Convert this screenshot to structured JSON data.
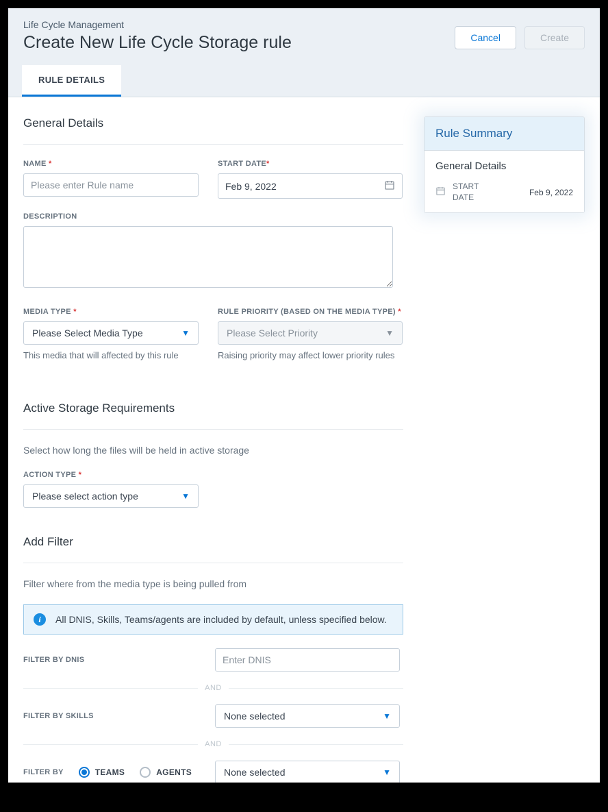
{
  "breadcrumb": "Life Cycle Management",
  "pageTitle": "Create New Life Cycle Storage rule",
  "buttons": {
    "cancel": "Cancel",
    "create": "Create"
  },
  "tab": "RULE DETAILS",
  "sections": {
    "general": {
      "title": "General Details",
      "nameLabel": "NAME",
      "namePlaceholder": "Please enter Rule name",
      "startDateLabel": "START DATE",
      "startDateValue": "Feb 9, 2022",
      "descriptionLabel": "DESCRIPTION",
      "mediaTypeLabel": "MEDIA TYPE",
      "mediaTypePlaceholder": "Please Select Media Type",
      "mediaTypeHelper": "This media that will affected by this rule",
      "priorityLabel": "RULE PRIORITY (BASED ON THE MEDIA TYPE)",
      "priorityPlaceholder": "Please Select Priority",
      "priorityHelper": "Raising priority may affect lower priority rules"
    },
    "storage": {
      "title": "Active Storage Requirements",
      "subtext": "Select how long the files will be held in active storage",
      "actionLabel": "ACTION TYPE",
      "actionPlaceholder": "Please select action type"
    },
    "filter": {
      "title": "Add Filter",
      "subtext": "Filter where from the media type is being pulled from",
      "infoText": "All DNIS, Skills, Teams/agents are included by default, unless specified below.",
      "dnisLabel": "FILTER BY DNIS",
      "dnisPlaceholder": "Enter DNIS",
      "and": "AND",
      "skillsLabel": "FILTER BY SKILLS",
      "skillsPlaceholder": "None selected",
      "byLabel": "FILTER BY",
      "teams": "TEAMS",
      "agents": "AGENTS",
      "byPlaceholder": "None selected"
    }
  },
  "summary": {
    "title": "Rule Summary",
    "section": "General Details",
    "startLabel": "START DATE",
    "startValue": "Feb 9, 2022"
  }
}
